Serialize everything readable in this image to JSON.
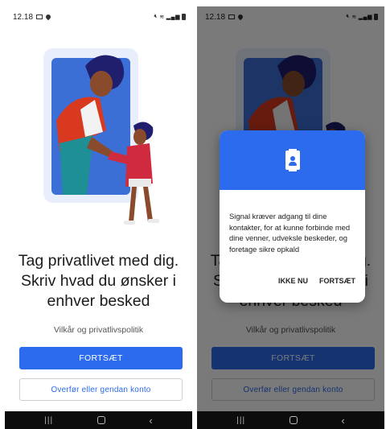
{
  "status_bar": {
    "time": "12.18",
    "network_text": "4G"
  },
  "illustration": {
    "name": "onboarding-illustration"
  },
  "onboarding": {
    "title_line1": "Tag privatlivet med dig.",
    "title_line2": "Skriv hvad du ønsker i",
    "title_line3": "enhver besked",
    "terms_link": "Vilkår og privatlivspolitik",
    "continue_label": "FORTSÆT",
    "transfer_label": "Overfør eller gendan konto"
  },
  "dialog": {
    "message": "Signal kræver adgang til dine kontakter, for at kunne forbinde med dine venner, udveksle beskeder, og foretage sikre opkald",
    "not_now_label": "IKKE NU",
    "continue_label": "FORTSÆT"
  },
  "nav": {
    "recents_icon": "recents-icon",
    "home_icon": "home-icon",
    "back_icon": "back-icon"
  },
  "colors": {
    "accent": "#2c6bed",
    "navbar": "#0c0c0c",
    "scrim": "rgba(0,0,0,0.52)"
  }
}
